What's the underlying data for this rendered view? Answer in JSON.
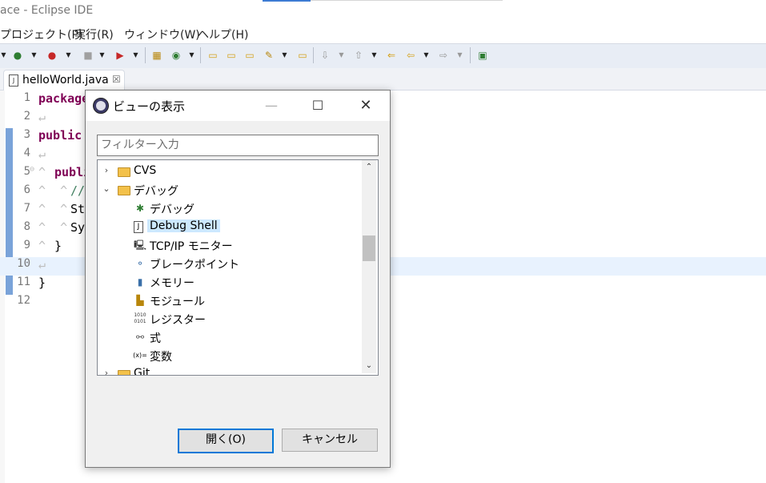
{
  "window": {
    "title": "ace - Eclipse IDE"
  },
  "menu": [
    {
      "label": "プロジェクト(P)"
    },
    {
      "label": "実行(R)"
    },
    {
      "label": "ウィンドウ(W)"
    },
    {
      "label": "ヘルプ(H)"
    }
  ],
  "editor": {
    "tab_label": "helloWorld.java",
    "lines": [
      {
        "num": "1",
        "code": "package"
      },
      {
        "num": "2",
        "code": ""
      },
      {
        "num": "3",
        "code": "public c"
      },
      {
        "num": "4",
        "code": ""
      },
      {
        "num": "5",
        "code": "publi"
      },
      {
        "num": "6",
        "code": "//"
      },
      {
        "num": "7",
        "code": "St"
      },
      {
        "num": "8",
        "code": "Sy"
      },
      {
        "num": "9",
        "code": "}"
      },
      {
        "num": "10",
        "code": ""
      },
      {
        "num": "11",
        "code": "}"
      },
      {
        "num": "12",
        "code": ""
      }
    ]
  },
  "dialog": {
    "title": "ビューの表示",
    "filter_placeholder": "フィルター入力",
    "tree": [
      {
        "label": "CVS",
        "type": "folder",
        "expanded": false
      },
      {
        "label": "デバッグ",
        "type": "folder",
        "expanded": true
      },
      {
        "label": "デバッグ",
        "type": "item",
        "icon": "bug-icon"
      },
      {
        "label": "Debug Shell",
        "type": "item",
        "icon": "java-file-icon",
        "selected": true
      },
      {
        "label": "TCP/IP モニター",
        "type": "item",
        "icon": "monitor-icon"
      },
      {
        "label": "ブレークポイント",
        "type": "item",
        "icon": "breakpoint-icon"
      },
      {
        "label": "メモリー",
        "type": "item",
        "icon": "memory-icon"
      },
      {
        "label": "モジュール",
        "type": "item",
        "icon": "module-icon"
      },
      {
        "label": "レジスター",
        "type": "item",
        "icon": "register-icon"
      },
      {
        "label": "式",
        "type": "item",
        "icon": "expression-icon"
      },
      {
        "label": "変数",
        "type": "item",
        "icon": "variable-icon"
      },
      {
        "label": "Git",
        "type": "folder",
        "expanded": false
      }
    ],
    "open_button": "開く(O)",
    "cancel_button": "キャンセル"
  },
  "colors": {
    "accent": "#0078d7",
    "selection": "#cce8ff",
    "keyword": "#7f0055",
    "toolbar_bg": "#e8edf5"
  }
}
